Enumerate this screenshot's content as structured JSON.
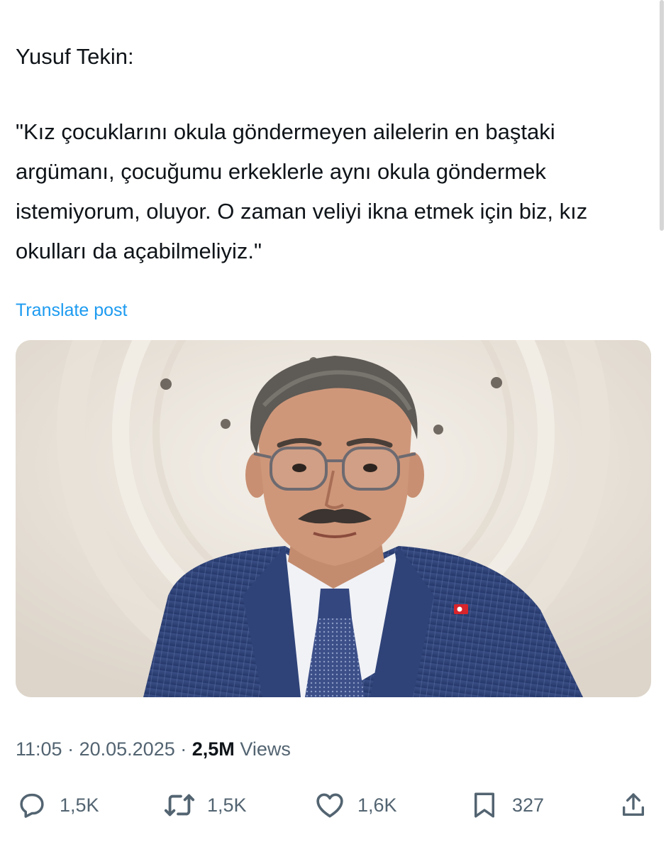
{
  "post": {
    "author_line": "Yusuf Tekin:",
    "quote": "\"Kız çocuklarını okula göndermeyen ailelerin en baştaki argümanı, çocuğumu erkeklerle aynı okula göndermek istemiyorum, oluyor. O zaman veliyi ikna etmek için biz, kız okulları da açabilmeliyiz.\"",
    "translate_label": "Translate post"
  },
  "meta": {
    "time": "11:05",
    "separator": "·",
    "date": "20.05.2025",
    "views_count": "2,5M",
    "views_label": "Views"
  },
  "actions": {
    "replies": "1,5K",
    "reposts": "1,5K",
    "likes": "1,6K",
    "bookmarks": "327"
  },
  "icons": {
    "reply": "reply-bubble-icon",
    "repost": "repost-arrows-icon",
    "like": "heart-icon",
    "bookmark": "bookmark-icon",
    "share": "share-upload-icon"
  },
  "colors": {
    "link": "#1d9bf0",
    "muted": "#536471",
    "text": "#0f1419"
  }
}
